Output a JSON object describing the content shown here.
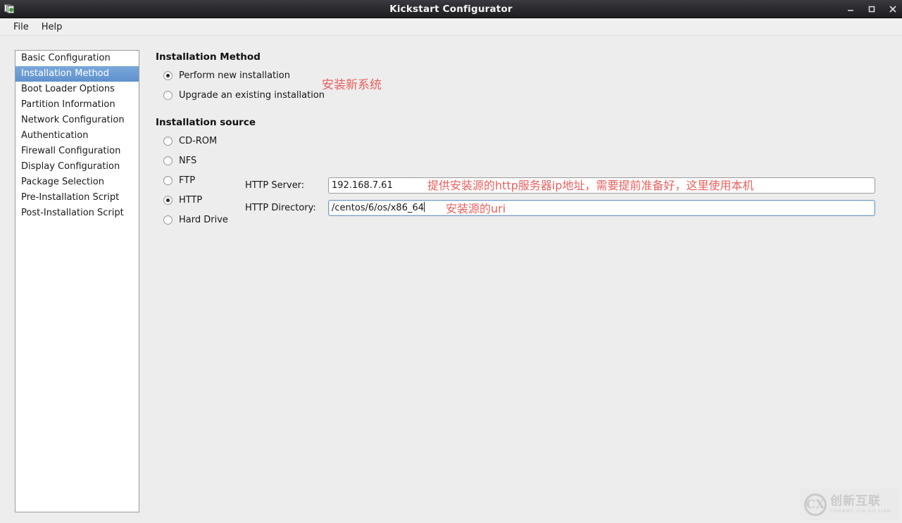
{
  "window": {
    "title": "Kickstart Configurator",
    "app_icon": "documents-icon",
    "controls": {
      "minimize": "minimize-icon",
      "maximize": "maximize-icon",
      "close": "close-icon"
    }
  },
  "menubar": {
    "items": [
      {
        "label": "File"
      },
      {
        "label": "Help"
      }
    ]
  },
  "sidebar": {
    "items": [
      {
        "label": "Basic Configuration",
        "selected": false
      },
      {
        "label": "Installation Method",
        "selected": true
      },
      {
        "label": "Boot Loader Options",
        "selected": false
      },
      {
        "label": "Partition Information",
        "selected": false
      },
      {
        "label": "Network Configuration",
        "selected": false
      },
      {
        "label": "Authentication",
        "selected": false
      },
      {
        "label": "Firewall Configuration",
        "selected": false
      },
      {
        "label": "Display Configuration",
        "selected": false
      },
      {
        "label": "Package Selection",
        "selected": false
      },
      {
        "label": "Pre-Installation Script",
        "selected": false
      },
      {
        "label": "Post-Installation Script",
        "selected": false
      }
    ]
  },
  "main": {
    "installation_method": {
      "heading": "Installation Method",
      "options": [
        {
          "label": "Perform new installation",
          "selected": true
        },
        {
          "label": "Upgrade an existing installation",
          "selected": false
        }
      ]
    },
    "installation_source": {
      "heading": "Installation source",
      "options": [
        {
          "label": "CD-ROM",
          "selected": false
        },
        {
          "label": "NFS",
          "selected": false
        },
        {
          "label": "FTP",
          "selected": false
        },
        {
          "label": "HTTP",
          "selected": true
        },
        {
          "label": "Hard Drive",
          "selected": false
        }
      ],
      "fields": {
        "http_server": {
          "label": "HTTP Server:",
          "value": "192.168.7.61",
          "focused": false
        },
        "http_directory": {
          "label": "HTTP Directory:",
          "value": "/centos/6/os/x86_64",
          "focused": true
        }
      }
    }
  },
  "annotations": {
    "color": "#e8625f",
    "install_new_system": "安装新系统",
    "http_server_note": "提供安装源的http服务器ip地址，需要提前准备好，这里使用本机",
    "http_directory_note": "安装源的uri"
  },
  "watermark": {
    "logo_text": "CX",
    "cn": "创新互联",
    "en": "CHUANG XIN HU LIAN"
  }
}
